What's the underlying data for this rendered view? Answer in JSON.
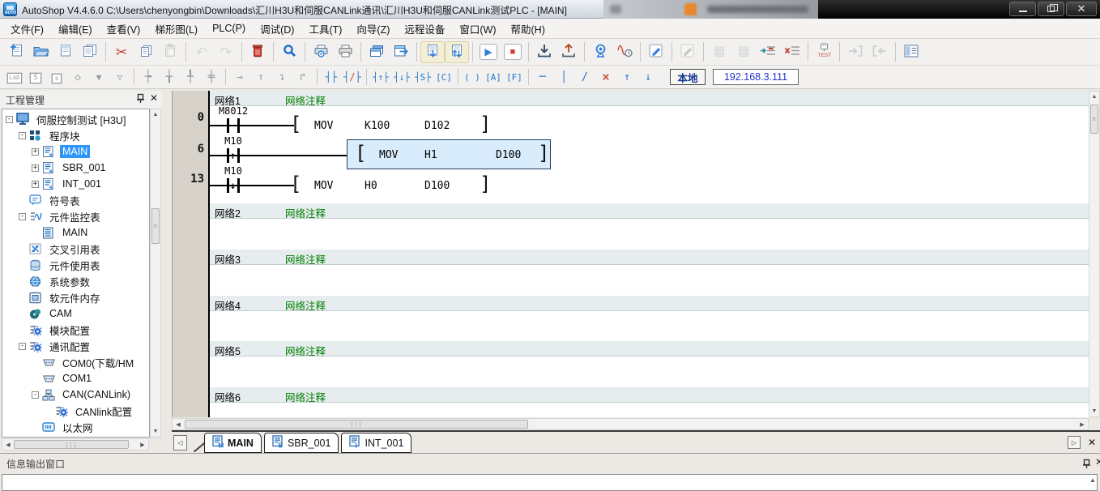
{
  "titlebar": {
    "title": "AutoShop V4.4.6.0  C:\\Users\\chenyongbin\\Downloads\\汇川H3U和伺服CANLink通讯\\汇川H3U和伺服CANLink测试PLC - [MAIN]"
  },
  "menu": {
    "items": [
      "文件(F)",
      "编辑(E)",
      "查看(V)",
      "梯形图(L)",
      "PLC(P)",
      "调试(D)",
      "工具(T)",
      "向导(Z)",
      "远程设备",
      "窗口(W)",
      "帮助(H)"
    ]
  },
  "toolbar": {
    "main_icons": [
      "new-file",
      "open-file",
      "save-file",
      "save-all",
      "|",
      "cut",
      "copy",
      "!paste",
      "|",
      "!undo",
      "!redo",
      "|",
      "delete",
      "|",
      "search",
      "|",
      "print-preview",
      "print",
      "|",
      "cascade-windows",
      "export-window",
      "|",
      "*download-list",
      "*upload-list",
      "|",
      "run",
      "stop",
      "|",
      "download-plc",
      "upload-plc",
      "|",
      "monitor",
      "trace",
      "|",
      "write-mode",
      "|",
      "!edit-mode",
      "|",
      "!convert",
      "!convert-delete",
      "insert-row",
      "delete-row",
      "|",
      "test",
      "|",
      "!jump-in",
      "!jump-out",
      "|",
      "memory-view"
    ],
    "ladder_icons": [
      "lad-tool",
      "s-tool-big",
      "s-tool-small",
      "net-diamond",
      "net-tri-filled",
      "net-tri-open",
      "|",
      "branch-1",
      "branch-2",
      "branch-3",
      "branch-4",
      "|",
      "arrow-right",
      "arrow-up",
      "arrow-corner-down",
      "arrow-corner-up",
      "|",
      "contact-no",
      "contact-nc",
      "|",
      "contact-rising",
      "contact-falling",
      "contact-set",
      "coil-c",
      "|",
      "coil-out",
      "coil-a",
      "coil-f",
      "|",
      "line-horizontal",
      "line-vertical",
      "line-delete",
      "line-cross-delete",
      "extend-up",
      "extend-down"
    ],
    "local_button": "本地",
    "ip_address": "192.168.3.111"
  },
  "project_panel": {
    "title": "工程管理",
    "tree": [
      {
        "label": "伺服控制测试 [H3U]",
        "icon": "monitor",
        "depth": 0,
        "expand": "-",
        "selected": false
      },
      {
        "label": "程序块",
        "icon": "blocks",
        "depth": 1,
        "expand": "-",
        "selected": false
      },
      {
        "label": "MAIN",
        "icon": "prog",
        "depth": 2,
        "expand": "+",
        "selected": true
      },
      {
        "label": "SBR_001",
        "icon": "prog",
        "depth": 2,
        "expand": "+",
        "selected": false
      },
      {
        "label": "INT_001",
        "icon": "prog",
        "depth": 2,
        "expand": "+",
        "selected": false
      },
      {
        "label": "符号表",
        "icon": "symbol",
        "depth": 1,
        "expand": "",
        "selected": false
      },
      {
        "label": "元件监控表",
        "icon": "watch",
        "depth": 1,
        "expand": "-",
        "selected": false
      },
      {
        "label": "MAIN",
        "icon": "doc",
        "depth": 2,
        "expand": "",
        "selected": false
      },
      {
        "label": "交叉引用表",
        "icon": "xref",
        "depth": 1,
        "expand": "",
        "selected": false
      },
      {
        "label": "元件使用表",
        "icon": "usage",
        "depth": 1,
        "expand": "",
        "selected": false
      },
      {
        "label": "系统参数",
        "icon": "sysparam",
        "depth": 1,
        "expand": "",
        "selected": false
      },
      {
        "label": "软元件内存",
        "icon": "devmem",
        "depth": 1,
        "expand": "",
        "selected": false
      },
      {
        "label": "CAM",
        "icon": "cam",
        "depth": 1,
        "expand": "",
        "selected": false
      },
      {
        "label": "模块配置",
        "icon": "config",
        "depth": 1,
        "expand": "",
        "selected": false
      },
      {
        "label": "通讯配置",
        "icon": "config",
        "depth": 1,
        "expand": "-",
        "selected": false
      },
      {
        "label": "COM0(下载/HM",
        "icon": "serial",
        "depth": 2,
        "expand": "",
        "selected": false
      },
      {
        "label": "COM1",
        "icon": "serial",
        "depth": 2,
        "expand": "",
        "selected": false
      },
      {
        "label": "CAN(CANLink)",
        "icon": "can",
        "depth": 2,
        "expand": "-",
        "selected": false
      },
      {
        "label": "CANlink配置",
        "icon": "config",
        "depth": 3,
        "expand": "",
        "selected": false
      },
      {
        "label": "以太网",
        "icon": "eth",
        "depth": 2,
        "expand": "",
        "selected": false
      },
      {
        "label": "",
        "icon": "monitor",
        "depth": 0,
        "expand": "",
        "selected": false
      }
    ]
  },
  "editor": {
    "networks": [
      {
        "name": "网络1",
        "comment": "网络注释"
      },
      {
        "name": "网络2",
        "comment": "网络注释"
      },
      {
        "name": "网络3",
        "comment": "网络注释"
      },
      {
        "name": "网络4",
        "comment": "网络注释"
      },
      {
        "name": "网络5",
        "comment": "网络注释"
      },
      {
        "name": "网络6",
        "comment": "网络注释"
      }
    ],
    "rungs": [
      {
        "row": "0",
        "contact": "M8012",
        "edge": "",
        "op": "MOV",
        "a1": "K100",
        "a2": "D102",
        "lbr": "[",
        "rbr": "]",
        "selected": false
      },
      {
        "row": "6",
        "contact": "M10",
        "edge": "↑",
        "op": "MOV",
        "a1": "H1",
        "a2": "D100",
        "lbr": "[",
        "rbr": "]",
        "selected": true
      },
      {
        "row": "13",
        "contact": "M10",
        "edge": "↓",
        "op": "MOV",
        "a1": "H0",
        "a2": "D100",
        "lbr": "[",
        "rbr": "]",
        "selected": false
      }
    ],
    "tabs": [
      {
        "label": "MAIN",
        "letter": "M",
        "active": true
      },
      {
        "label": "SBR_001",
        "letter": "S",
        "active": false
      },
      {
        "label": "INT_001",
        "letter": "I",
        "active": false
      }
    ]
  },
  "output_panel": {
    "title": "信息输出窗口"
  },
  "colors": {
    "selection_blue": "#2f96fb",
    "comment_green": "#008000",
    "network_band": "#e7edef",
    "selected_block_fill": "#d9ecfb",
    "ip_text": "#2233cc"
  }
}
